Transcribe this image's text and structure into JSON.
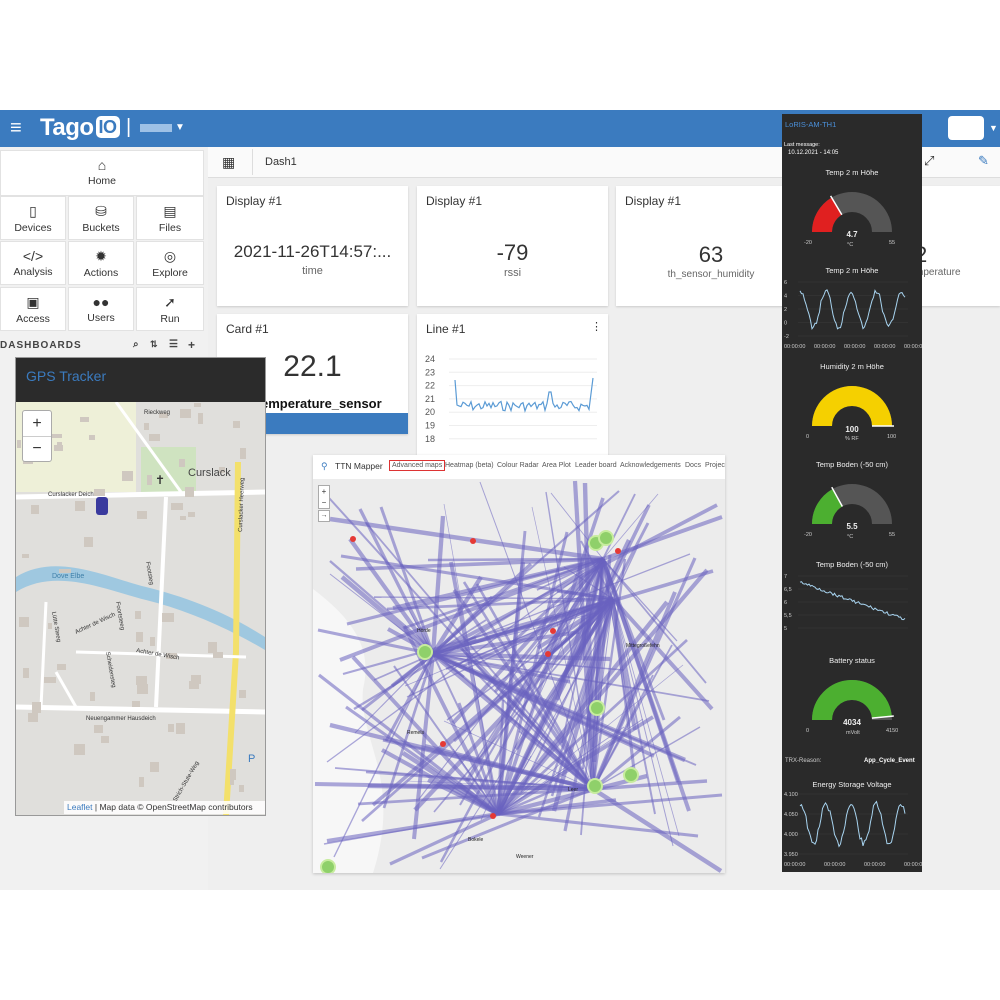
{
  "topbar": {
    "logo_text": "Tago",
    "logo_badge": "IO",
    "separator": "|"
  },
  "sidebar": {
    "tiles": [
      {
        "label": "Home",
        "icon": "home-icon",
        "glyph": "⌂"
      },
      {
        "label": "Devices",
        "icon": "device-icon",
        "glyph": "▯"
      },
      {
        "label": "Buckets",
        "icon": "bucket-icon",
        "glyph": "⛁"
      },
      {
        "label": "Files",
        "icon": "files-icon",
        "glyph": "▤"
      },
      {
        "label": "Analysis",
        "icon": "code-icon",
        "glyph": "</>"
      },
      {
        "label": "Actions",
        "icon": "fire-icon",
        "glyph": "✹"
      },
      {
        "label": "Explore",
        "icon": "compass-icon",
        "glyph": "◎"
      },
      {
        "label": "Access",
        "icon": "lock-icon",
        "glyph": "🔒"
      },
      {
        "label": "Users",
        "icon": "users-icon",
        "glyph": "●●"
      },
      {
        "label": "Run",
        "icon": "rocket-icon",
        "glyph": "➚"
      }
    ],
    "dashboards_label": "DASHBOARDS"
  },
  "breadcrumb": {
    "dashboard": "Dash1"
  },
  "widgets": {
    "d1": {
      "title": "Display #1",
      "value": "2021-11-26T14:57:...",
      "label": "time"
    },
    "d2": {
      "title": "Display #1",
      "value": "-79",
      "label": "rssi"
    },
    "d3": {
      "title": "Display #1",
      "value": "63",
      "label": "th_sensor_humidity"
    },
    "d4": {
      "value": "2",
      "label": "mperature"
    },
    "card": {
      "title": "Card #1",
      "value": "22.1",
      "label": "emperature_sensor"
    },
    "line": {
      "title": "Line #1",
      "yticks": [
        "24",
        "23",
        "22",
        "21",
        "20",
        "19",
        "18"
      ]
    }
  },
  "gps": {
    "title": "GPS Tracker",
    "zoom_in": "+",
    "zoom_out": "−",
    "labels": {
      "rieckweg": "Rieckweg",
      "curslack": "Curslack",
      "deich": "Curslacker Deich",
      "footsteg": "Footsteg",
      "heerweg": "Curslacker Heerweg",
      "dove": "Dove Elbe",
      "lutte": "Lütte Steeg",
      "achter1": "Achter de Wisch",
      "achter2": "Achter de Wisch",
      "scheide": "Scheidensteg",
      "footsteeg": "Foortsteeg",
      "neuengammer": "Neuengammer Hausdeich",
      "strich": "Strich-Stute-Weg"
    },
    "attribution_link": "Leaflet",
    "attribution": "| Map data © OpenStreetMap contributors"
  },
  "ttn": {
    "title": "TTN Mapper",
    "nav": [
      "Advanced maps",
      "Heatmap (beta)",
      "Colour Radar",
      "Area Plot",
      "Leader board",
      "Acknowledgements",
      "Docs",
      "Projec"
    ],
    "places": [
      "Hörde",
      "Mittegroßefehn",
      "Remels",
      "Leer",
      "Bokele",
      "Weener"
    ]
  },
  "lora": {
    "title": "LoRIS-AM-TH1",
    "last_message_label": "Last message:",
    "last_message": "10.12.2021 - 14:05",
    "g1": {
      "title": "Temp 2 m Höhe",
      "value": "4.7",
      "unit": "°C",
      "min": "-20",
      "max": "55",
      "fraction": 0.33
    },
    "c1": {
      "title": "Temp 2 m Höhe",
      "yticks": [
        "6",
        "4",
        "2",
        "0",
        "-2"
      ],
      "xticks": [
        "00:00:00",
        "00:00:00",
        "00:00:00",
        "00:00:00",
        "00:00:00"
      ]
    },
    "g2": {
      "title": "Humidity 2 m Höhe",
      "value": "100",
      "unit": "% RF",
      "min": "0",
      "max": "100",
      "fraction": 1.0
    },
    "g3": {
      "title": "Temp Boden (-50 cm)",
      "value": "5.5",
      "unit": "°C",
      "min": "-20",
      "max": "55",
      "fraction": 0.34
    },
    "c2": {
      "title": "Temp Boden (-50 cm)",
      "yticks": [
        "7",
        "6,5",
        "6",
        "5,5",
        "5"
      ]
    },
    "g4": {
      "title": "Battery status",
      "value": "4034",
      "unit": "mVolt",
      "min": "0",
      "max": "4150",
      "fraction": 0.97
    },
    "trx_label": "TRX-Reason:",
    "trx_value": "App_Cycle_Event",
    "c3": {
      "title": "Energy Storage Voltage",
      "yticks": [
        "4.100",
        "4.050",
        "4.000",
        "3.950"
      ],
      "xticks": [
        "00:00:00",
        "00:00:00",
        "00:00:00",
        "00:00:00"
      ]
    },
    "colors": {
      "cold": "#e02020",
      "humid": "#f5d000",
      "soil": "#4caf30",
      "battery": "#4caf30",
      "track": "#555555"
    }
  }
}
